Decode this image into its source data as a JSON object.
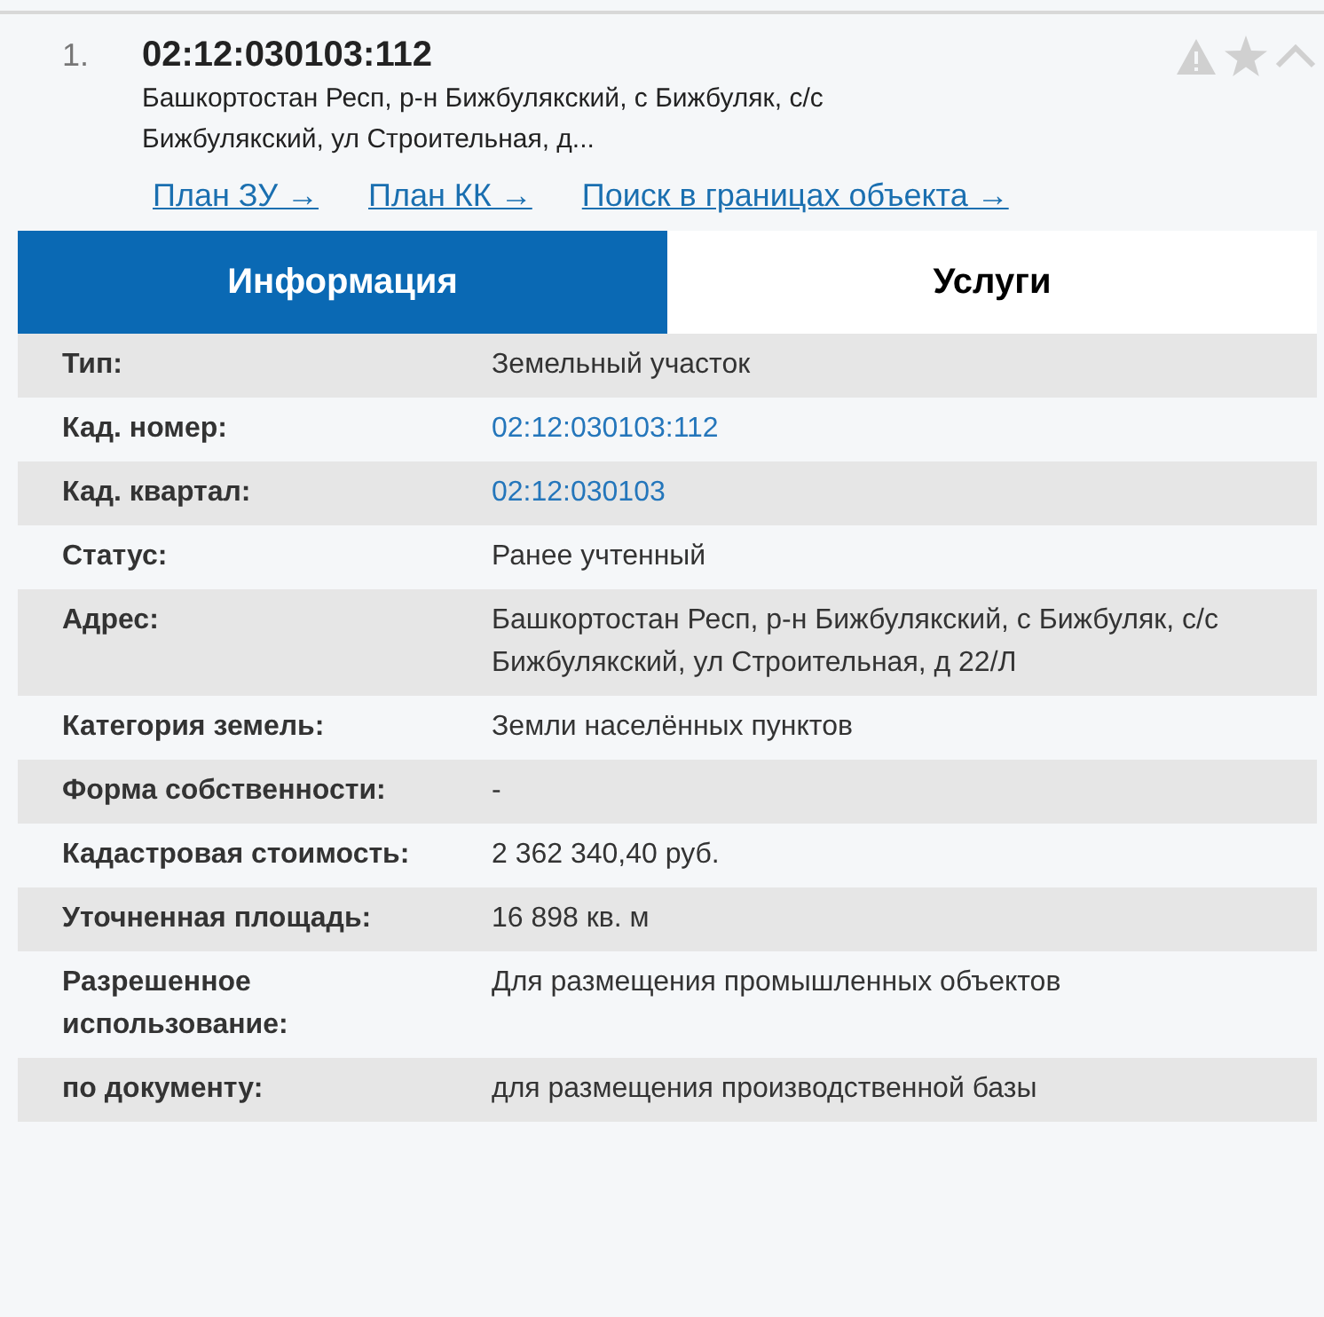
{
  "result": {
    "index": "1.",
    "cad_number": "02:12:030103:112",
    "address": "Башкортостан Респ, р-н Бижбулякский, с Бижбуляк, с/с Бижбулякский, ул Строительная, д..."
  },
  "links": [
    "План ЗУ →",
    "План КК →",
    "Поиск в границах объекта →"
  ],
  "tabs": [
    {
      "label": "Информация",
      "selected": true
    },
    {
      "label": "Услуги",
      "selected": false
    }
  ],
  "rows": [
    {
      "label": "Тип:",
      "value": "Земельный участок",
      "kind": "text"
    },
    {
      "label": "Кад. номер:",
      "value": "02:12:030103:112",
      "kind": "link"
    },
    {
      "label": "Кад. квартал:",
      "value": "02:12:030103",
      "kind": "link"
    },
    {
      "label": "Статус:",
      "value": "Ранее учтенный",
      "kind": "text"
    },
    {
      "label": "Адрес:",
      "value": "Башкортостан Респ, р-н Бижбулякский, с Бижбуляк, с/с Бижбулякский, ул Строительная, д 22/Л",
      "kind": "text"
    },
    {
      "label": "Категория земель:",
      "value": "Земли населённых пунктов",
      "kind": "text"
    },
    {
      "label": "Форма собственности:",
      "value": "-",
      "kind": "text"
    },
    {
      "label": "Кадастровая стоимость:",
      "value": "2 362 340,40 руб.",
      "kind": "text"
    },
    {
      "label": "Уточненная площадь:",
      "value": "16 898 кв. м",
      "kind": "text"
    },
    {
      "label": "Разрешенное использование:",
      "value": "Для размещения промышленных объектов",
      "kind": "text"
    },
    {
      "label": "по документу:",
      "value": "для размещения производственной базы",
      "kind": "text"
    }
  ]
}
